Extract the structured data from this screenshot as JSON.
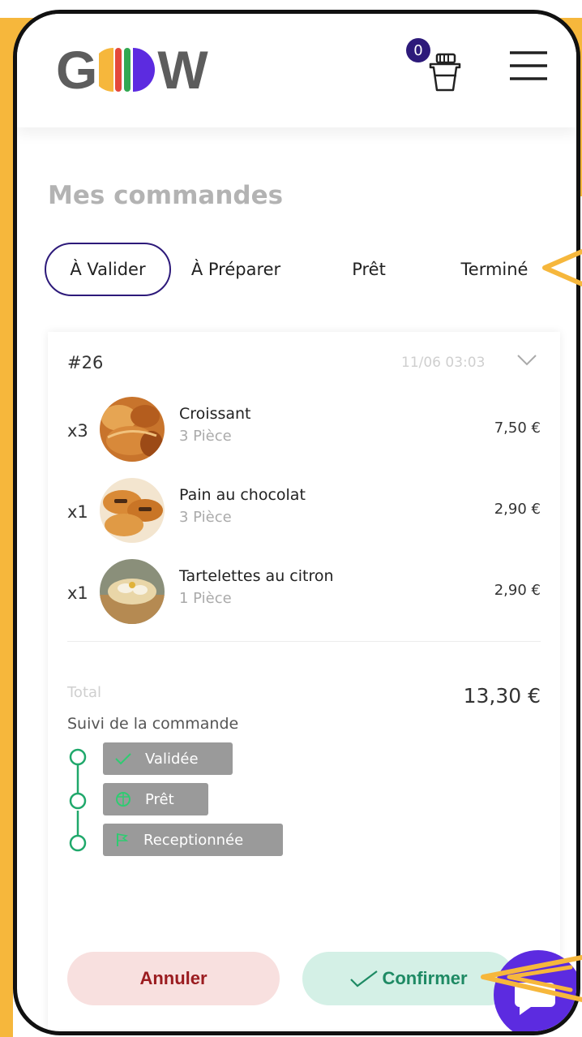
{
  "header": {
    "logo_letter_left": "G",
    "logo_letter_right": "W",
    "cart_count": "0",
    "logo_colors": [
      "#f6b73c",
      "#e4483b",
      "#32a852",
      "#5c2be0"
    ]
  },
  "page": {
    "title": "Mes commandes"
  },
  "tabs": [
    {
      "label": "À Valider",
      "active": true
    },
    {
      "label": "À Préparer",
      "active": false
    },
    {
      "label": "Prêt",
      "active": false
    },
    {
      "label": "Terminé",
      "active": false
    }
  ],
  "order": {
    "id": "#26",
    "date": "11/06 03:03",
    "items": [
      {
        "qty": "x3",
        "name": "Croissant",
        "sub": "3 Pièce",
        "price": "7,50 €"
      },
      {
        "qty": "x1",
        "name": "Pain au chocolat",
        "sub": "3 Pièce",
        "price": "2,90 €"
      },
      {
        "qty": "x1",
        "name": "Tartelettes au citron",
        "sub": "1 Pièce",
        "price": "2,90 €"
      }
    ],
    "total_label": "Total",
    "total_value": "13,30 €",
    "tracking_title": "Suivi de la commande",
    "tracking_steps": [
      {
        "label": "Validée",
        "icon": "check-icon"
      },
      {
        "label": "Prêt",
        "icon": "box-icon"
      },
      {
        "label": "Receptionnée",
        "icon": "flag-icon"
      }
    ]
  },
  "actions": {
    "cancel_label": "Annuler",
    "confirm_label": "Confirmer"
  },
  "colors": {
    "accent": "#2d1a7a",
    "highlight": "#f6b73c",
    "cancel": "#9b1c20",
    "confirm": "#1e8a64",
    "timeline": "#1fa86b",
    "fab": "#5c2be0"
  }
}
